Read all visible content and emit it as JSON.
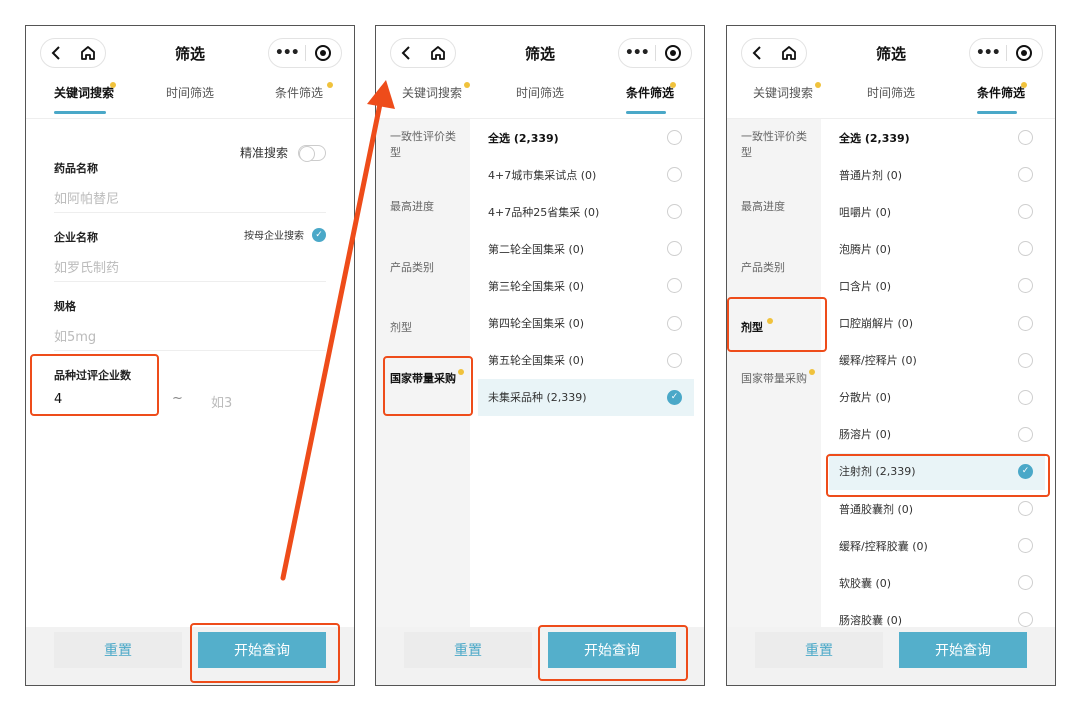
{
  "nav": {
    "title": "筛选",
    "more_icon": "more-dots-icon",
    "close_icon": "target-icon"
  },
  "tabs": {
    "keyword": "关键词搜索",
    "time": "时间筛选",
    "condition": "条件筛选"
  },
  "keyword_form": {
    "exact_search": "精准搜索",
    "drug_name_label": "药品名称",
    "drug_name_placeholder": "如阿帕替尼",
    "company_label": "企业名称",
    "company_placeholder": "如罗氏制药",
    "mother_company_search": "按母企业搜索",
    "spec_label": "规格",
    "spec_placeholder": "如5mg",
    "count_label": "品种过评企业数",
    "count_min": "4",
    "count_tilde": "~",
    "count_max_placeholder": "如3"
  },
  "sidebar": [
    "一致性评价类型",
    "最高进度",
    "产品类别",
    "剂型",
    "国家带量采购"
  ],
  "procurement_options": [
    "全选 (2,339)",
    "4+7城市集采试点 (0)",
    "4+7品种25省集采 (0)",
    "第二轮全国集采 (0)",
    "第三轮全国集采 (0)",
    "第四轮全国集采 (0)",
    "第五轮全国集采 (0)",
    "未集采品种 (2,339)"
  ],
  "dosage_options": [
    "全选 (2,339)",
    "普通片剂 (0)",
    "咀嚼片 (0)",
    "泡腾片 (0)",
    "口含片 (0)",
    "口腔崩解片 (0)",
    "缓释/控释片 (0)",
    "分散片 (0)",
    "肠溶片 (0)",
    "注射剂 (2,339)",
    "普通胶囊剂 (0)",
    "缓释/控释胶囊 (0)",
    "软胶囊 (0)",
    "肠溶胶囊 (0)"
  ],
  "footer": {
    "reset": "重置",
    "query": "开始查询"
  },
  "colors": {
    "accent": "#4aa8c8",
    "highlight": "#ee4c1a",
    "badge": "#f0c23c"
  }
}
